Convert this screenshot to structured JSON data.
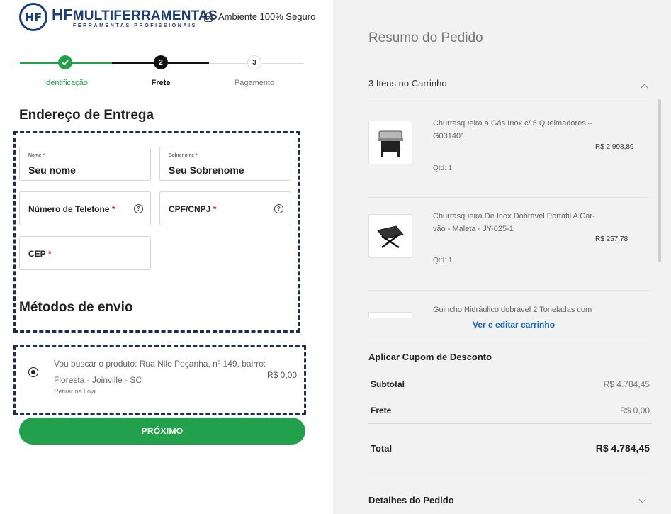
{
  "header": {
    "logo_mark": "HF",
    "logo_hf": "HF",
    "logo_name": "MULTIFERRAMENTAS",
    "logo_tagline": "FERRAMENTAS PROFISSIONAIS",
    "secure_label": "Ambiente 100% Seguro"
  },
  "stepper": {
    "steps": [
      {
        "number": "",
        "label": "Identificação",
        "status": "done"
      },
      {
        "number": "2",
        "label": "Frete",
        "status": "active"
      },
      {
        "number": "3",
        "label": "Pagamento",
        "status": "pending"
      }
    ]
  },
  "address": {
    "title": "Endereço de Entrega",
    "first_name": {
      "label": "Nome",
      "value": "Seu nome"
    },
    "last_name": {
      "label": "Sobrenome",
      "value": "Seu Sobrenome"
    },
    "phone": {
      "placeholder": "Número de Telefone"
    },
    "cpf": {
      "placeholder": "CPF/CNPJ"
    },
    "cep": {
      "placeholder": "CEP"
    },
    "required_mark": "*"
  },
  "shipping": {
    "title": "Métodos de envio",
    "option_text": "Vou buscar o produto: Rua Nilo Peçanha, nº 149, bairro: Floresta - Joinville - SC",
    "option_sub": "Retirar na Loja",
    "option_price": "R$ 0,00"
  },
  "next_button": "PRÓXIMO",
  "summary": {
    "title": "Resumo do Pedido",
    "cart_header": "3 Itens no Carrinho",
    "items": [
      {
        "name": "Churrasqueira a Gás Inox c/ 5 Queimadores – G031401",
        "price": "R$ 2.998,89",
        "qty": "Qtd: 1"
      },
      {
        "name": "Churrasqueira De Inox Dobrável Portátil A Car-vão - Maleta - JY-025-1",
        "price": "R$ 257,78",
        "qty": "Qtd: 1"
      },
      {
        "name": "Guincho Hidráulico dobrável 2 Toneladas com",
        "price": "",
        "qty": ""
      }
    ],
    "edit_link": "Ver e editar carrinho",
    "coupon": "Aplicar Cupom de Desconto",
    "subtotal_label": "Subtotal",
    "subtotal_value": "R$ 4.784,45",
    "shipping_label": "Frete",
    "shipping_value": "R$ 0,00",
    "total_label": "Total",
    "total_value": "R$ 4.784,45",
    "details": "Detalhes do Pedido"
  },
  "colors": {
    "brand": "#1c3e78",
    "green": "#22a04b",
    "dash": "#1a2e52"
  }
}
